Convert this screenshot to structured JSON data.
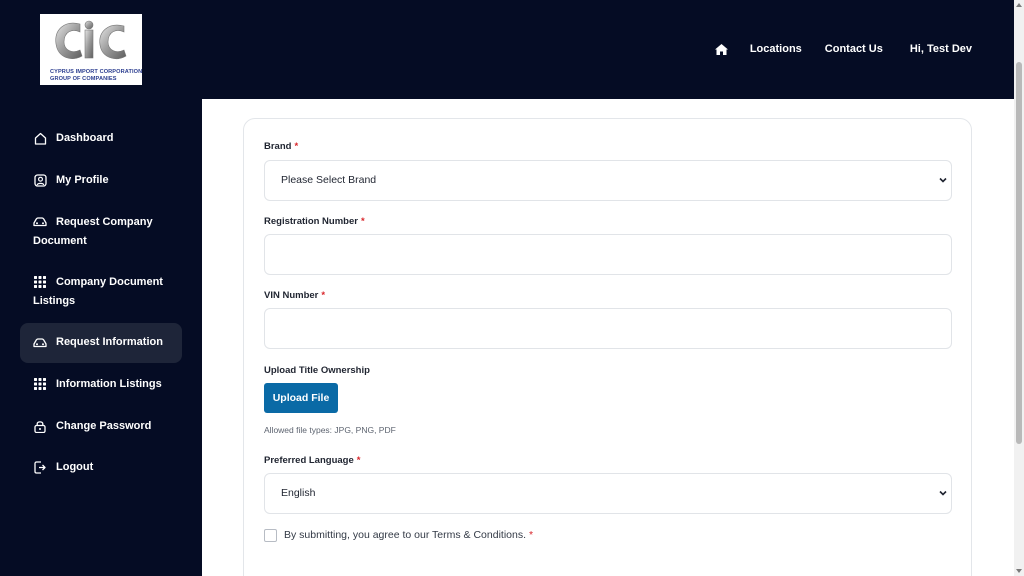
{
  "logo": {
    "line1": "CYPRUS IMPORT CORPORATION",
    "line2": "GROUP OF COMPANIES"
  },
  "topnav": {
    "home_icon": "home-icon",
    "locations": "Locations",
    "contact": "Contact Us",
    "greeting": "Hi, Test Dev"
  },
  "sidebar": {
    "items": [
      {
        "icon": "home-outline-icon",
        "label": "Dashboard"
      },
      {
        "icon": "user-square-icon",
        "label": "My Profile"
      },
      {
        "icon": "car-icon",
        "label": "Request Company",
        "label2": "Document"
      },
      {
        "icon": "grid-icon",
        "label": "Company Document",
        "label2": "Listings"
      },
      {
        "icon": "car-icon",
        "label": "Request Information",
        "active": true
      },
      {
        "icon": "grid-icon",
        "label": "Information Listings"
      },
      {
        "icon": "lock-icon",
        "label": "Change Password"
      },
      {
        "icon": "logout-icon",
        "label": "Logout"
      }
    ]
  },
  "form": {
    "brand": {
      "label": "Brand",
      "required": "*",
      "value": "Please Select Brand"
    },
    "registration": {
      "label": "Registration Number",
      "required": "*",
      "value": ""
    },
    "vin": {
      "label": "VIN Number",
      "required": "*",
      "value": ""
    },
    "upload": {
      "label": "Upload Title Ownership",
      "button": "Upload File",
      "hint": "Allowed file types: JPG, PNG, PDF"
    },
    "language": {
      "label": "Preferred Language",
      "required": "*",
      "value": "English"
    },
    "agree": {
      "text": "By submitting, you agree to our Terms & Conditions.",
      "required": "*"
    }
  },
  "colors": {
    "page_bg": "#050c24",
    "active_item": "#1e2539",
    "primary_button": "#0a6aa6",
    "required": "#d9262b"
  }
}
